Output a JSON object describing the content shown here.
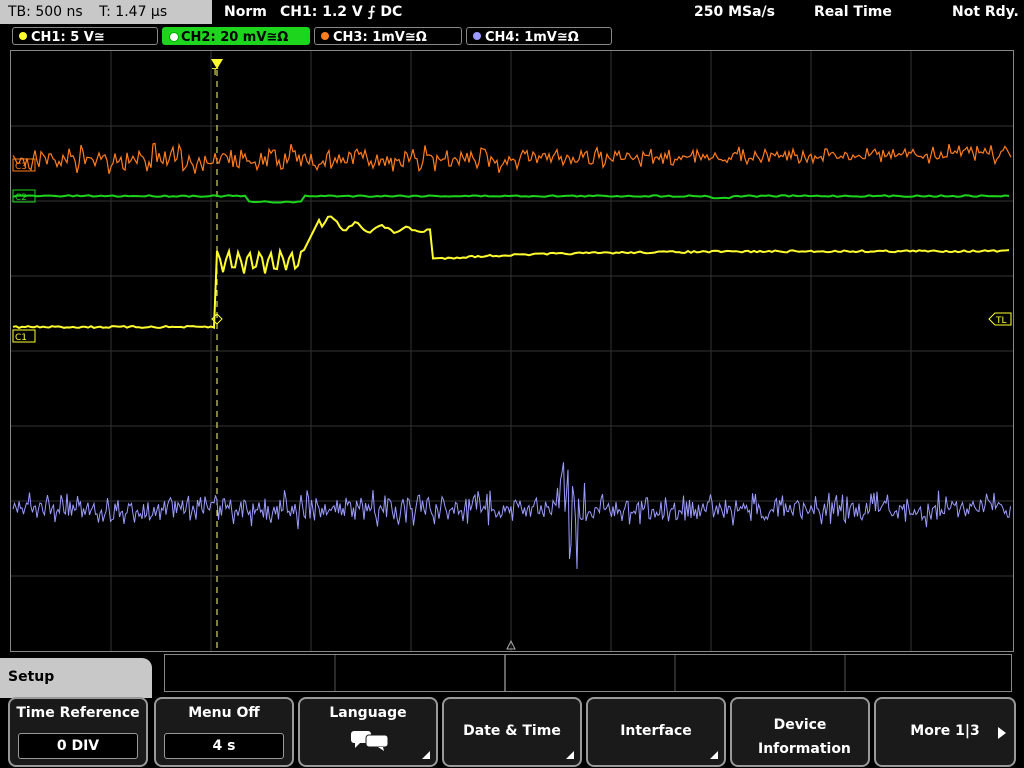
{
  "status": {
    "tb": "TB: 500 ns",
    "trigger_time": "T: 1.47 µs",
    "mode": "Norm",
    "trigger_source": "CH1: 1.2 V ⨍ DC",
    "sample_rate": "250 MSa/s",
    "acq_mode": "Real Time",
    "ready": "Not Rdy."
  },
  "channels": [
    {
      "label": "CH1: 5 V≅",
      "color": "#ffff30"
    },
    {
      "label": "CH2: 20 mV≅Ω",
      "color": "#1cd51c"
    },
    {
      "label": "CH3: 1mV≅Ω",
      "color": "#ff7d1e"
    },
    {
      "label": "CH4: 1mV≅Ω",
      "color": "#9b9bff"
    }
  ],
  "markers": {
    "ch3": "C3",
    "ch2": "C2",
    "ch1": "C1",
    "trigger_level": "TL",
    "trigger_pos": "T"
  },
  "setup": {
    "title": "Setup",
    "buttons": [
      {
        "label": "Time Reference",
        "value": "0 DIV"
      },
      {
        "label": "Menu Off",
        "value": "4 s"
      },
      {
        "label": "Language"
      },
      {
        "label": "Date & Time"
      },
      {
        "label": "Interface"
      },
      {
        "label": "Device Information"
      },
      {
        "label": "More 1|3"
      }
    ]
  }
}
